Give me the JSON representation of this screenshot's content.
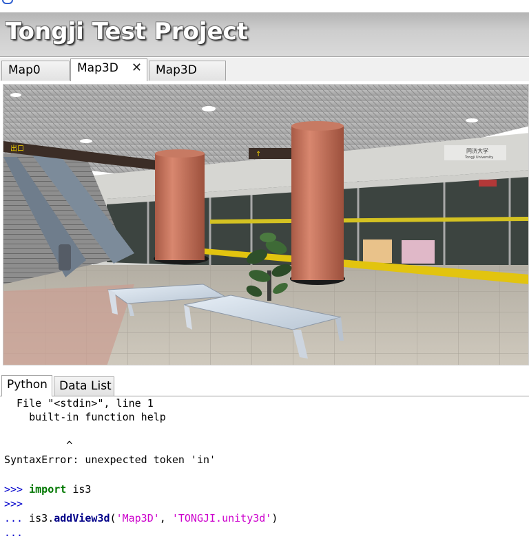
{
  "app": {
    "title": "Tongji Test Project"
  },
  "map_tabs": [
    {
      "label": "Map0",
      "active": false
    },
    {
      "label": "Map3D",
      "active": true,
      "close": "✕"
    },
    {
      "label": "Map3D",
      "active": false
    }
  ],
  "viewport": {
    "scene": "3d-subway-platform-view",
    "signs": {
      "exit": "出口",
      "station_name": "同济大学",
      "station_name_en": "Tongji University"
    }
  },
  "console_tabs": [
    {
      "label": "Python",
      "active": true
    },
    {
      "label": "Data List",
      "active": false
    }
  ],
  "console": {
    "lines": [
      {
        "text": "  File \"<stdin>\", line 1"
      },
      {
        "text": "    built-in function help"
      },
      {
        "text": ""
      },
      {
        "text": "          ^"
      },
      {
        "text": "SyntaxError: unexpected token 'in'"
      },
      {
        "text": ""
      }
    ],
    "cmd1": {
      "prompt": ">>>",
      "keyword": "import",
      "rest": " is3"
    },
    "cmd2": {
      "prompt": ">>>"
    },
    "cmd3": {
      "prompt": "...",
      "obj": " is3.",
      "func": "addView3d",
      "open": "(",
      "arg1": "'Map3D'",
      "sep": ", ",
      "arg2": "'TONGJI.unity3d'",
      "close": ")"
    },
    "cmd4": {
      "prompt": "..."
    }
  },
  "colors": {
    "prompt": "#0000cc",
    "keyword": "#007700",
    "string": "#cc00cc",
    "pillar": "#c0745e"
  }
}
